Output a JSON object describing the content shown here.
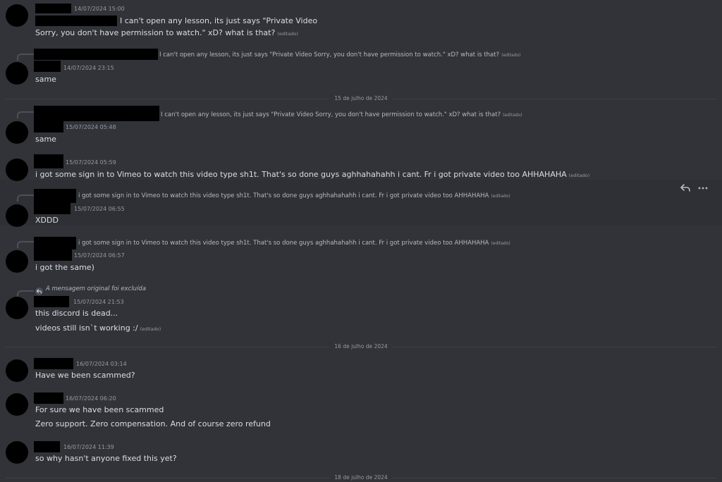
{
  "date_dividers": {
    "d1": "15 de julho de 2024",
    "d2": "16 de julho de 2024",
    "d3": "18 de julho de 2024"
  },
  "messages": {
    "m1": {
      "timestamp": "14/07/2024 15:00",
      "line1": "I can't open any lesson, its just says \"Private Video",
      "line2": "Sorry, you don't have permission to watch.\" xD? what is that?",
      "edited": "(editado)"
    },
    "m2": {
      "reply": "I can't open any lesson, its just says \"Private Video Sorry, you don't have permission to watch.\" xD? what is that?",
      "reply_edited": "(editado)",
      "timestamp": "14/07/2024 23:15",
      "text": "same"
    },
    "m3": {
      "reply": "I can't open any lesson, its just says \"Private Video Sorry, you don't have permission to watch.\" xD? what is that?",
      "reply_edited": "(editado)",
      "timestamp": "15/07/2024 05:48",
      "text": "same"
    },
    "m4": {
      "timestamp": "15/07/2024 05:59",
      "text": "i got some sign in to Vimeo to watch this video type sh1t. That's so done guys aghhahahahh i cant. Fr i got private video too AHHAHAHA",
      "edited": "(editado)"
    },
    "m5": {
      "reply": "i got some sign in to Vimeo to watch this video type sh1t. That's so done guys aghhahahahh i cant. Fr i got private video too AHHAHAHA",
      "reply_edited": "(editado)",
      "timestamp": "15/07/2024 06:55",
      "text": "XDDD"
    },
    "m6": {
      "reply": "i got some sign in to Vimeo to watch this video type sh1t. That's so done guys aghhahahahh i cant. Fr i got private video too AHHAHAHA",
      "reply_edited": "(editado)",
      "timestamp": "15/07/2024 06:57",
      "text": "i got the same)"
    },
    "m7": {
      "reply_deleted": "A mensagem original foi excluída",
      "timestamp": "15/07/2024 21:53",
      "line1": "this discord is dead...",
      "line2": "videos still isn`t working :/",
      "edited": "(editado)"
    },
    "m8": {
      "timestamp": "16/07/2024 03:14",
      "text": "Have we been scammed?"
    },
    "m9": {
      "timestamp": "16/07/2024 06:20",
      "line1": "For sure we have been scammed",
      "line2": "Zero support. Zero compensation. And of course zero refund"
    },
    "m10": {
      "timestamp": "16/07/2024 11:39",
      "text": "so why hasn't anyone fixed this yet?"
    }
  },
  "hover_actions": {
    "reply_icon": "reply-arrow",
    "more_icon": "ellipsis"
  }
}
